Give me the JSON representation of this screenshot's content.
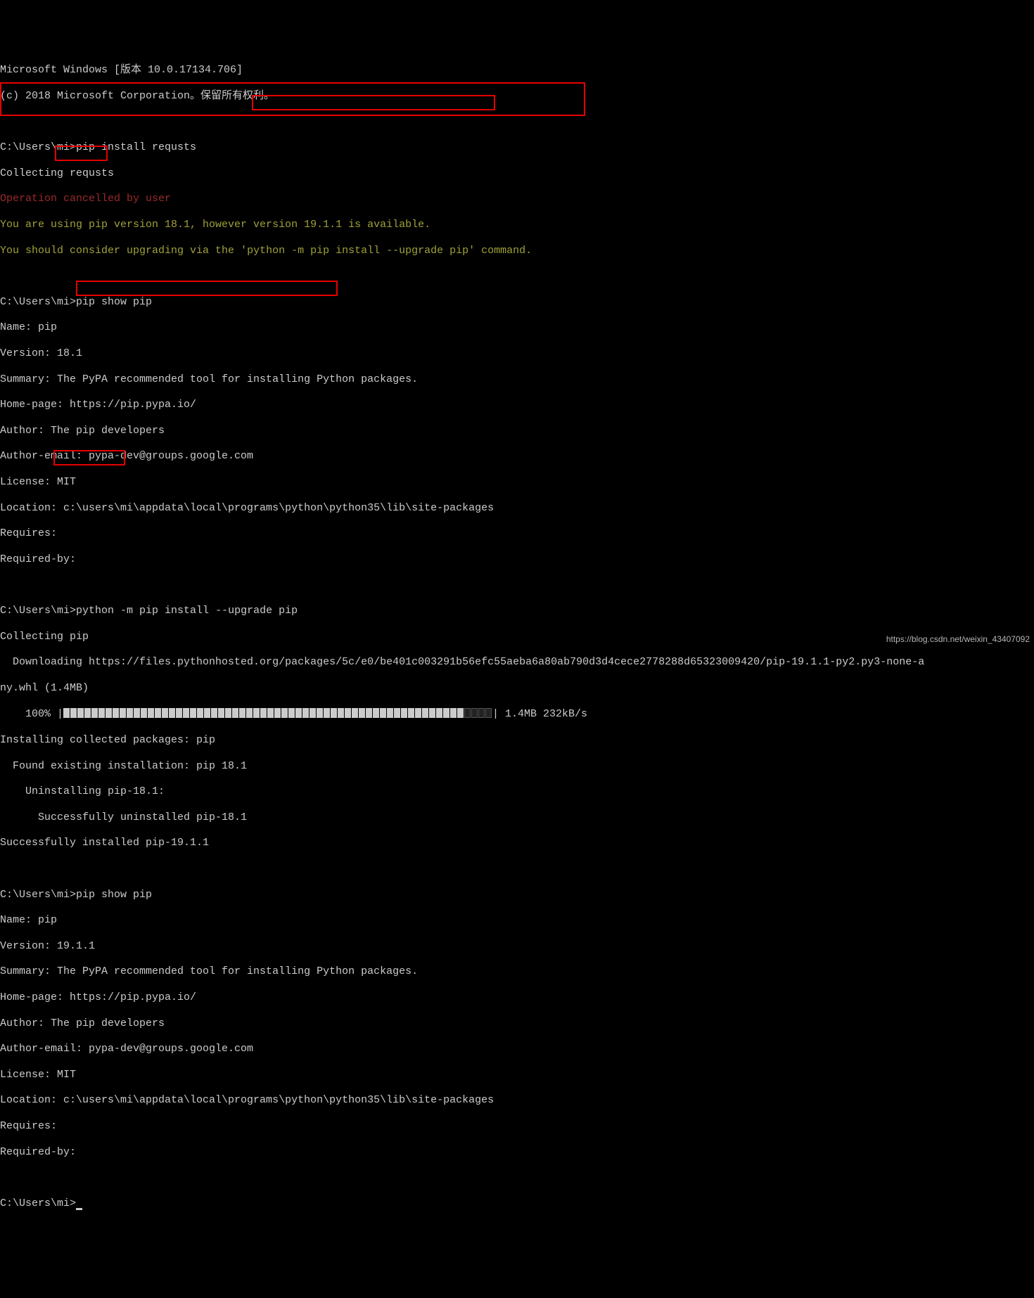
{
  "header": {
    "line1": "Microsoft Windows [版本 10.0.17134.706]",
    "line2": "(c) 2018 Microsoft Corporation。保留所有权利。"
  },
  "block1": {
    "prompt": "C:\\Users\\mi>",
    "cmd": "pip install requsts",
    "out1": "Collecting requsts",
    "err": "Operation cancelled by user",
    "warn1a": "You are using pip version 18.1, however version 19.1.1 is available.",
    "warn2a": "You should consider upgrading via the '",
    "warn2b": "python -m pip install --upgrade pip",
    "warn2c": "' command."
  },
  "block2": {
    "prompt": "C:\\Users\\mi>",
    "cmd": "pip show pip",
    "name": "Name: pip",
    "ver_label": "Version: ",
    "ver_val": "18.1",
    "summary": "Summary: The PyPA recommended tool for installing Python packages.",
    "home": "Home-page: https://pip.pypa.io/",
    "author": "Author: The pip developers",
    "email": "Author-email: pypa-dev@groups.google.com",
    "license": "License: MIT",
    "location": "Location: c:\\users\\mi\\appdata\\local\\programs\\python\\python35\\lib\\site-packages",
    "requires": "Requires:",
    "reqby": "Required-by:"
  },
  "block3": {
    "prompt": "C:\\Users\\mi>",
    "cmd": "python -m pip install --upgrade pip",
    "out1": "Collecting pip",
    "dl1": "  Downloading https://files.pythonhosted.org/packages/5c/e0/be401c003291b56efc55aeba6a80ab790d3d4cece2778288d65323009420/pip-19.1.1-py2.py3-none-a",
    "dl2": "ny.whl (1.4MB)",
    "progress_pct": "    100% |",
    "progress_rate": "| 1.4MB 232kB/s",
    "out2": "Installing collected packages: pip",
    "out3": "  Found existing installation: pip 18.1",
    "out4": "    Uninstalling pip-18.1:",
    "out5": "      Successfully uninstalled pip-18.1",
    "out6": "Successfully installed pip-19.1.1"
  },
  "block4": {
    "prompt": "C:\\Users\\mi>",
    "cmd": "pip show pip",
    "name": "Name: pip",
    "ver_label": "Version: ",
    "ver_val": "19.1.1",
    "summary": "Summary: The PyPA recommended tool for installing Python packages.",
    "home": "Home-page: https://pip.pypa.io/",
    "author": "Author: The pip developers",
    "email": "Author-email: pypa-dev@groups.google.com",
    "license": "License: MIT",
    "location": "Location: c:\\users\\mi\\appdata\\local\\programs\\python\\python35\\lib\\site-packages",
    "requires": "Requires:",
    "reqby": "Required-by:"
  },
  "final_prompt": "C:\\Users\\mi>",
  "watermark": "https://blog.csdn.net/weixin_43407092",
  "progress": {
    "filled": 57,
    "empty": 4
  },
  "highlight_boxes_color": "#e60000"
}
